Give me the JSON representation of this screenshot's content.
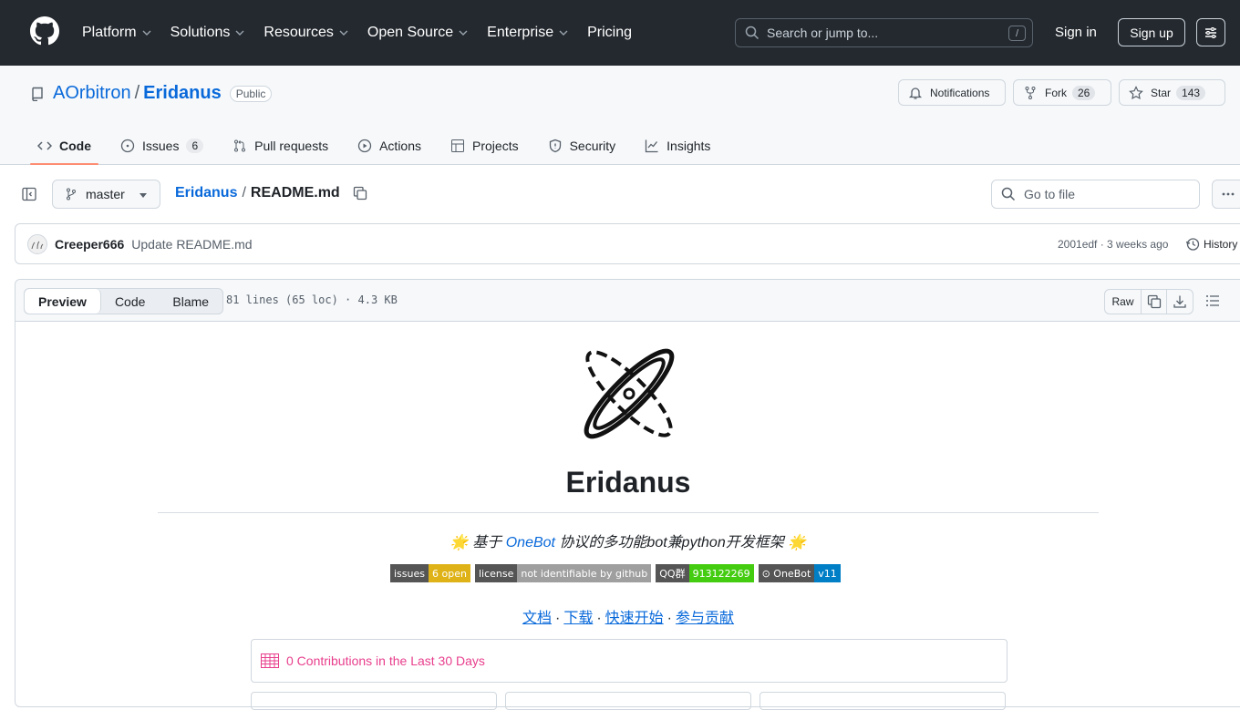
{
  "header": {
    "nav": [
      {
        "label": "Platform",
        "dropdown": true
      },
      {
        "label": "Solutions",
        "dropdown": true
      },
      {
        "label": "Resources",
        "dropdown": true
      },
      {
        "label": "Open Source",
        "dropdown": true
      },
      {
        "label": "Enterprise",
        "dropdown": true
      },
      {
        "label": "Pricing",
        "dropdown": false
      }
    ],
    "search_placeholder": "Search or jump to...",
    "search_shortcut": "/",
    "signin": "Sign in",
    "signup": "Sign up"
  },
  "repo": {
    "owner": "AOrbitron",
    "separator": "/",
    "name": "Eridanus",
    "visibility": "Public",
    "notifications": "Notifications",
    "fork_label": "Fork",
    "fork_count": "26",
    "star_label": "Star",
    "star_count": "143",
    "tabs": [
      {
        "label": "Code",
        "active": true,
        "count": null
      },
      {
        "label": "Issues",
        "active": false,
        "count": "6"
      },
      {
        "label": "Pull requests",
        "active": false,
        "count": null
      },
      {
        "label": "Actions",
        "active": false,
        "count": null
      },
      {
        "label": "Projects",
        "active": false,
        "count": null
      },
      {
        "label": "Security",
        "active": false,
        "count": null
      },
      {
        "label": "Insights",
        "active": false,
        "count": null
      }
    ]
  },
  "filebar": {
    "branch": "master",
    "crumb_repo": "Eridanus",
    "crumb_sep": "/",
    "crumb_file": "README.md",
    "goto_placeholder": "Go to file"
  },
  "commit": {
    "author": "Creeper666",
    "message": "Update README.md",
    "meta": "2001edf · 3 weeks ago",
    "history": "History"
  },
  "fileview": {
    "modes": [
      "Preview",
      "Code",
      "Blame"
    ],
    "active_mode": "Preview",
    "meta": "81 lines (65 loc) · 4.3 KB",
    "raw": "Raw"
  },
  "readme": {
    "title": "Eridanus",
    "subtitle_pre": "🌟 基于 ",
    "subtitle_link": "OneBot",
    "subtitle_post": " 协议的多功能bot兼python开发框架 🌟",
    "badges": [
      {
        "left": "issues",
        "right": "6 open",
        "color": "#dfb317"
      },
      {
        "left": "license",
        "right": "not identifiable by github",
        "color": "#9f9f9f"
      },
      {
        "left": "QQ群",
        "right": "913122269",
        "color": "#4c1"
      },
      {
        "left": "⊙ OneBot",
        "right": "v11",
        "color": "#007ec6"
      }
    ],
    "links": [
      "文档",
      "下载",
      "快速开始",
      "参与贡献"
    ],
    "link_sep": "·",
    "contrib": "0 Contributions in the Last 30 Days",
    "contrib_color": "#e83e8c"
  },
  "colors": {
    "header_bg": "#24292f",
    "link": "#0969da",
    "tab_underline": "#fd8c73"
  }
}
